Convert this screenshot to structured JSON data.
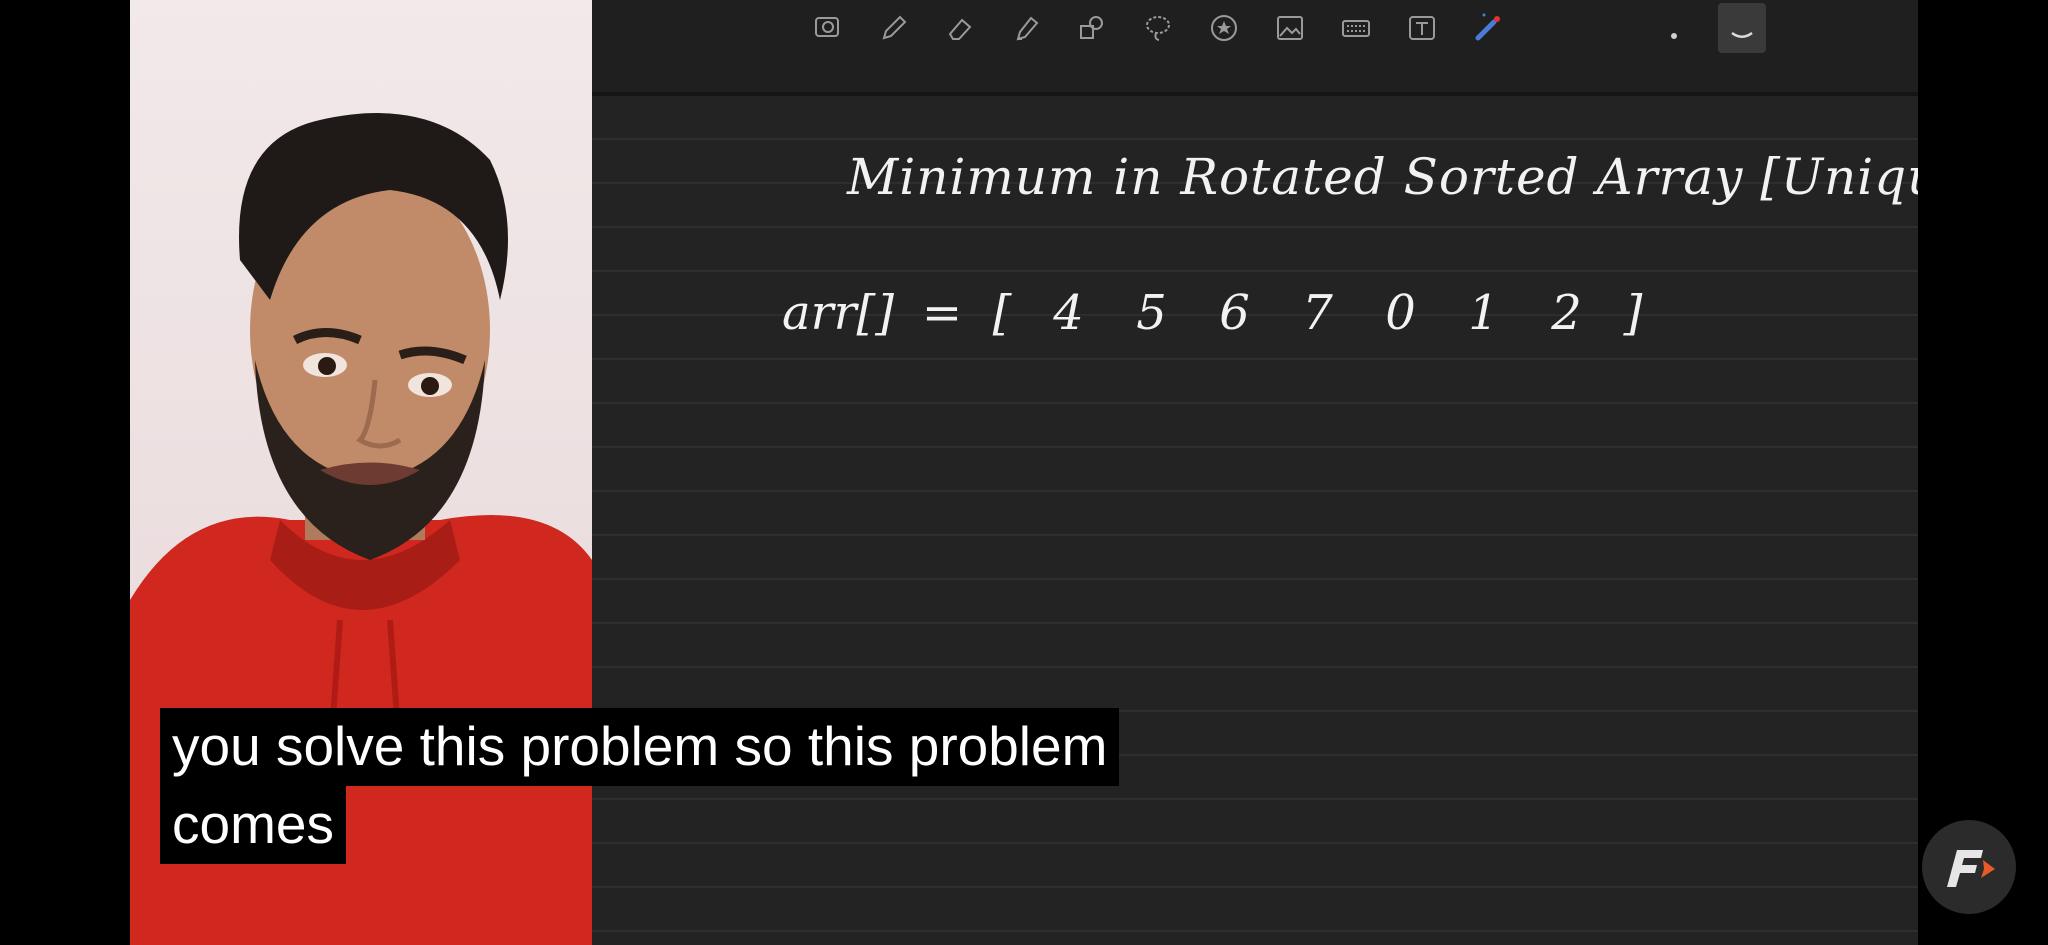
{
  "toolbar": {
    "tools": [
      {
        "name": "lasso-image-icon"
      },
      {
        "name": "pen-icon"
      },
      {
        "name": "eraser-icon"
      },
      {
        "name": "highlighter-icon"
      },
      {
        "name": "shapes-icon"
      },
      {
        "name": "lasso-icon"
      },
      {
        "name": "star-sticker-icon"
      },
      {
        "name": "image-icon"
      },
      {
        "name": "keyboard-icon"
      },
      {
        "name": "text-box-icon"
      },
      {
        "name": "laser-pointer-icon"
      }
    ]
  },
  "board": {
    "title": "Minimum in Rotated Sorted Array [Unique]",
    "array_name": "arr[]",
    "equals": "=",
    "open_bracket": "[",
    "close_bracket": "]",
    "values": [
      "4",
      "5",
      "6",
      "7",
      "0",
      "1",
      "2"
    ]
  },
  "captions": {
    "line1": "you solve this problem so this problem",
    "line2": "comes"
  },
  "colors": {
    "pen_accent": "#4a7bd6",
    "logo_accent": "#e85a2a"
  }
}
